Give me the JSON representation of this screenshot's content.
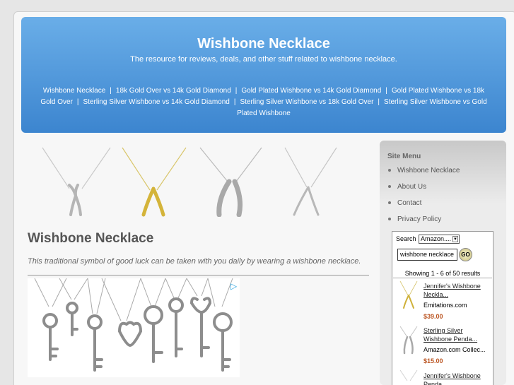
{
  "header": {
    "title": "Wishbone Necklace",
    "tagline": "The resource for reviews, deals, and other stuff related to wishbone necklace.",
    "nav": [
      "Wishbone Necklace",
      "18k Gold Over vs 14k Gold Diamond",
      "Gold Plated Wishbone vs 14k Gold Diamond",
      "Gold Plated Wishbone vs 18k Gold Over",
      "Sterling Silver Wishbone vs 14k Gold Diamond",
      "Sterling Silver Wishbone vs 18k Gold Over",
      "Sterling Silver Wishbone vs Gold Plated Wishbone"
    ],
    "nav_separator": "|"
  },
  "content": {
    "title": "Wishbone Necklace",
    "intro": "This traditional symbol of good luck can be taken with you daily by wearing a wishbone necklace."
  },
  "sidebar": {
    "menu_title": "Site Menu",
    "menu_items": [
      "Wishbone Necklace",
      "About Us",
      "Contact",
      "Privacy Policy"
    ],
    "widget": {
      "search_label": "Search",
      "search_select": "Amazon....",
      "search_value": "wishbone necklace",
      "go_label": "GO",
      "showing": "Showing 1 - 6 of 50 results",
      "results": [
        {
          "title": "Jennifer's Wishbone Neckla...",
          "merchant": "Emitations.com",
          "price": "$39.00"
        },
        {
          "title": "Sterling Silver Wishbone Penda...",
          "merchant": "Amazon.com Collec...",
          "price": "$15.00"
        },
        {
          "title": "Jennifer's Wishbone Penda..."
        }
      ]
    }
  },
  "colors": {
    "header_top": "#6aaee8",
    "header_bottom": "#3c85cf",
    "price": "#bb5522"
  }
}
